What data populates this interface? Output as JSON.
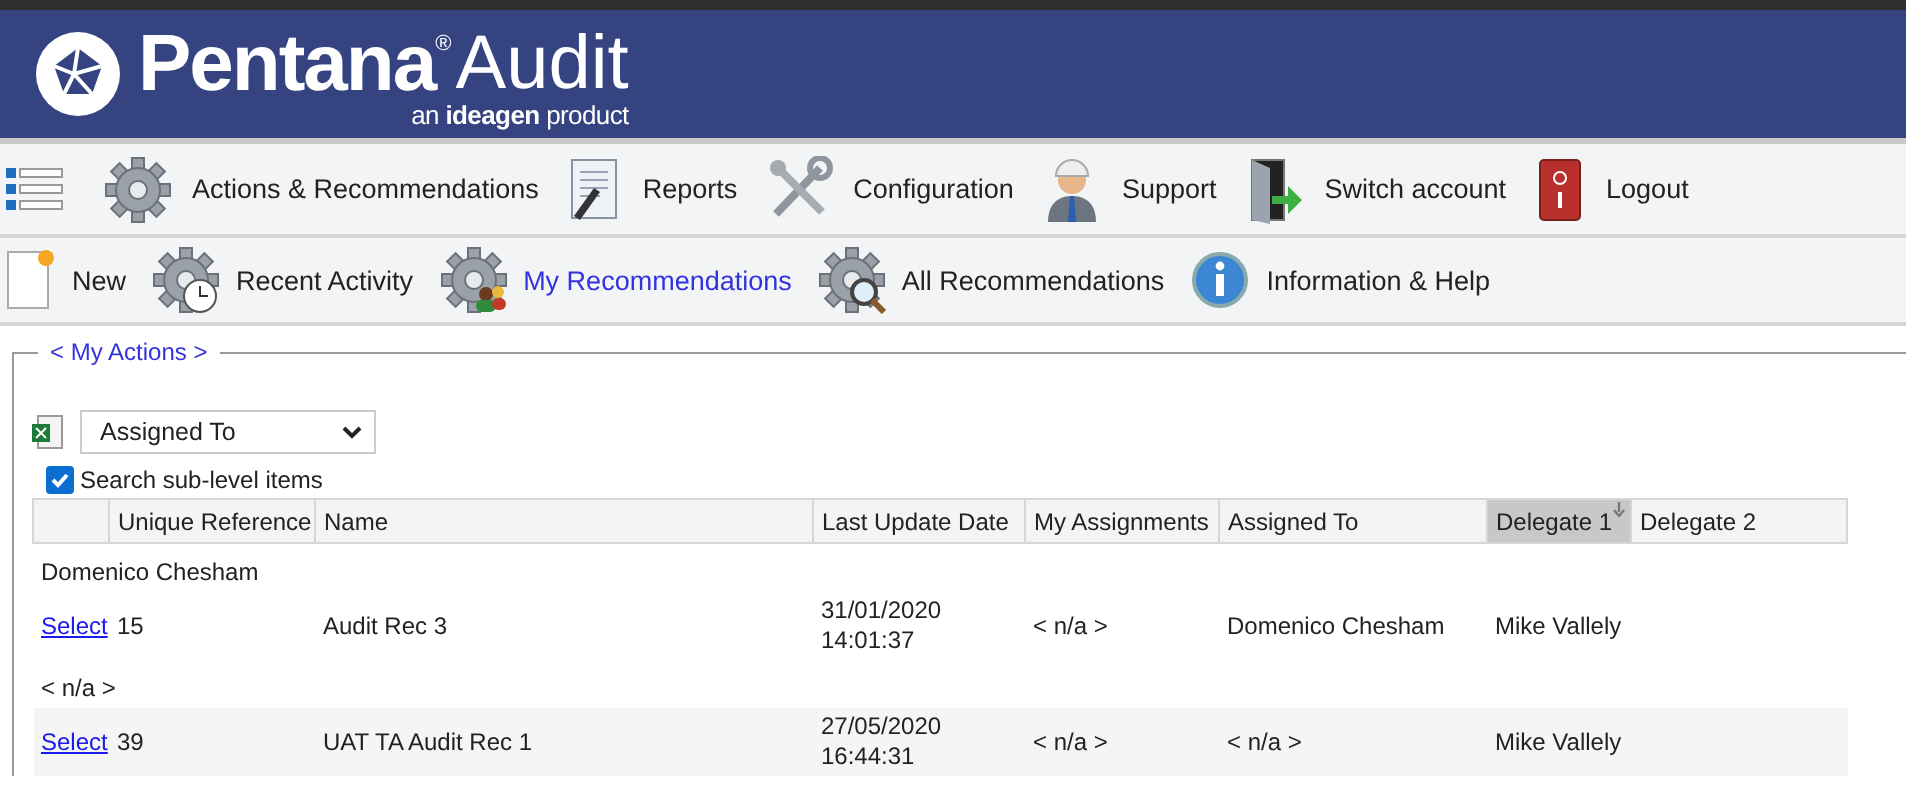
{
  "header": {
    "brand": "Pentana",
    "registered": "®",
    "product": "Audit",
    "tagline_pre": "an ",
    "tagline_brand": "ideagen",
    "tagline_post": " product"
  },
  "main_menu": [
    {
      "label": "Actions & Recommendations",
      "kind": "gear"
    },
    {
      "label": "Reports",
      "kind": "document"
    },
    {
      "label": "Configuration",
      "kind": "tools"
    },
    {
      "label": "Support",
      "kind": "person"
    },
    {
      "label": "Switch account",
      "kind": "door"
    },
    {
      "label": "Logout",
      "kind": "switch"
    }
  ],
  "sub_menu": [
    {
      "label": "New",
      "kind": "new",
      "selected": false
    },
    {
      "label": "Recent Activity",
      "kind": "gear-clock",
      "selected": false
    },
    {
      "label": "My Recommendations",
      "kind": "gear-people",
      "selected": true
    },
    {
      "label": "All Recommendations",
      "kind": "gear-search",
      "selected": false
    },
    {
      "label": "Information & Help",
      "kind": "info",
      "selected": false
    }
  ],
  "section": {
    "legend": "< My Actions >"
  },
  "group_by": {
    "value": "Assigned To"
  },
  "search_sub_level": {
    "label": "Search sub-level items",
    "checked": true
  },
  "table": {
    "columns": [
      {
        "sorted": false
      },
      {
        "label": "Unique Reference",
        "sorted": false
      },
      {
        "label": "Name",
        "sorted": false
      },
      {
        "label": "Last Update Date",
        "sorted": false
      },
      {
        "label": "My Assignments",
        "sorted": false
      },
      {
        "label": "Assigned To",
        "sorted": false
      },
      {
        "label": "Delegate 1",
        "sorted": true
      },
      {
        "label": "Delegate 2",
        "sorted": false
      }
    ],
    "groups": [
      {
        "label": "Domenico Chesham",
        "rows": [
          {
            "link": "Select",
            "cells": [
              "15",
              "Audit Rec 3",
              "31/01/2020\n14:01:37",
              "< n/a >",
              "Domenico Chesham",
              "Mike Vallely"
            ]
          }
        ]
      },
      {
        "label": "< n/a >",
        "rows": [
          {
            "link": "Select",
            "cells": [
              "39",
              "UAT TA Audit Rec 1",
              "27/05/2020\n16:44:31",
              "< n/a >",
              "< n/a >",
              "Mike Vallely"
            ]
          }
        ]
      }
    ]
  }
}
